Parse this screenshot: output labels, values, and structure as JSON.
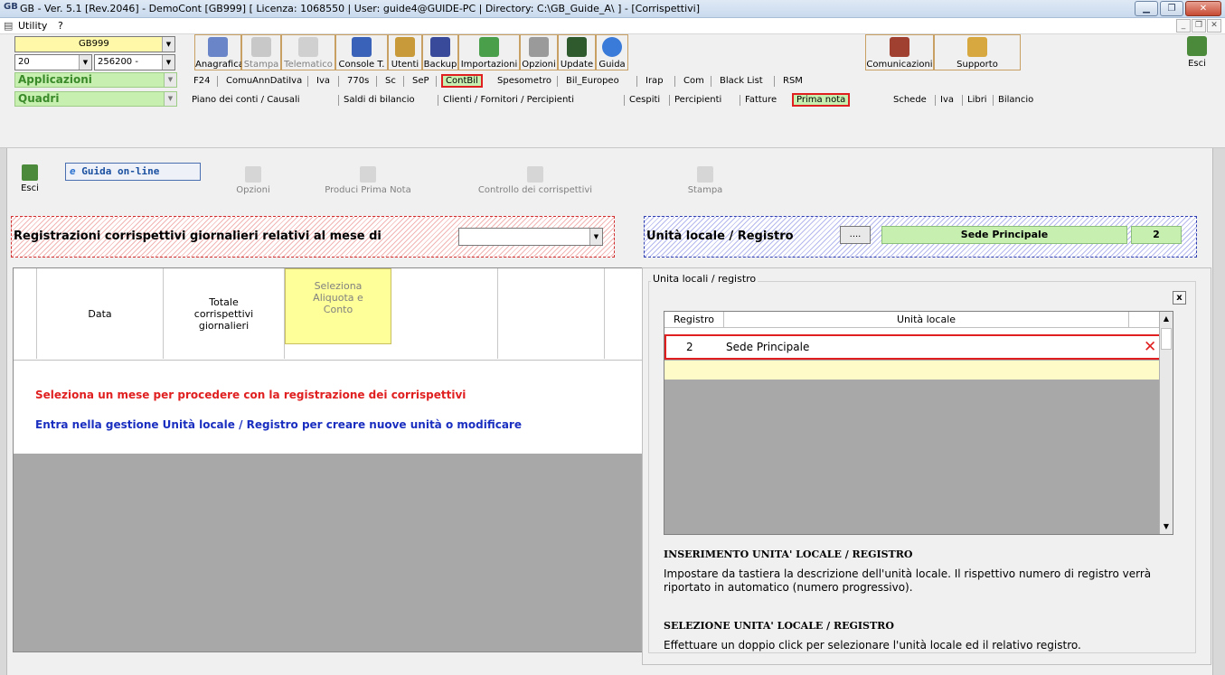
{
  "window": {
    "app_icon": "GB",
    "title": "GB - Ver. 5.1 [Rev.2046] - DemoCont [GB999]    [ Licenza: 1068550 | User: guide4@GUIDE-PC | Directory: C:\\GB_Guide_A\\ ] - [Corrispettivi]"
  },
  "menubar": {
    "utility": "Utility",
    "help": "?"
  },
  "toolbar": {
    "company_code": "GB999",
    "year": "20",
    "account_code": "256200 -",
    "buttons": [
      {
        "label": "Anagrafica",
        "icon": "address-book-icon"
      },
      {
        "label": "Stampa",
        "icon": "printer-icon"
      },
      {
        "label": "Telematico",
        "icon": "telematic-icon"
      },
      {
        "label": "Console T.",
        "icon": "console-icon"
      },
      {
        "label": "Utenti",
        "icon": "users-icon"
      },
      {
        "label": "Backup",
        "icon": "backup-icon"
      },
      {
        "label": "Importazioni",
        "icon": "import-icon"
      },
      {
        "label": "Opzioni",
        "icon": "tools-icon"
      },
      {
        "label": "Update",
        "icon": "update-icon"
      },
      {
        "label": "Guida",
        "icon": "help-icon"
      },
      {
        "label": "Comunicazioni",
        "icon": "communications-icon"
      },
      {
        "label": "Supporto",
        "icon": "support-icon"
      },
      {
        "label": "Esci",
        "icon": "exit-icon"
      }
    ],
    "applicazioni_label": "Applicazioni",
    "quadri_label": "Quadri",
    "apps": [
      "F24",
      "ComuAnnDatiIva",
      "Iva",
      "770s",
      "Sc",
      "SeP",
      "ContBil",
      "Spesometro",
      "Bil_Europeo",
      "Irap",
      "Com",
      "Black List",
      "RSM"
    ],
    "quadri": [
      "Piano dei conti / Causali",
      "Saldi di bilancio",
      "Clienti / Fornitori / Percipienti",
      "Cespiti",
      "Percipienti",
      "Fatture",
      "Prima nota",
      "Schede",
      "Iva",
      "Libri",
      "Bilancio"
    ]
  },
  "actions": {
    "exit": "Esci",
    "guida_online": "Guida on-line",
    "opzioni": "Opzioni",
    "produci": "Produci Prima Nota",
    "controllo": "Controllo dei corrispettivi",
    "stampa": "Stampa"
  },
  "month_box": {
    "label": "Registrazioni corrispettivi giornalieri relativi al mese di",
    "value": ""
  },
  "unit_box": {
    "label": "Unità locale / Registro",
    "button": "....",
    "unit": "Sede Principale",
    "number": "2"
  },
  "grid": {
    "headers": [
      "Data",
      "Totale corrispettivi giornalieri",
      "Seleziona Aliquota e Conto"
    ],
    "msg_red": "Seleziona un mese per procedere con la registrazione dei corrispettivi",
    "msg_blue": "Entra nella gestione Unità locale / Registro per creare nuove unità o modificare"
  },
  "panel": {
    "frame_title": "Unita locali / registro",
    "close": "x",
    "headers": [
      "Registro",
      "Unità locale"
    ],
    "rows": [
      {
        "registro": "2",
        "unita": "Sede Principale",
        "delete": "✕"
      }
    ],
    "h1": "INSERIMENTO UNITA' LOCALE / REGISTRO",
    "t1": "Impostare da tastiera la descrizione dell'unità locale. Il rispettivo numero di registro verrà riportato in automatico (numero progressivo).",
    "h2": "SELEZIONE UNITA' LOCALE / REGISTRO",
    "t2": "Effettuare un doppio click per selezionare l'unità locale ed il relativo registro."
  }
}
